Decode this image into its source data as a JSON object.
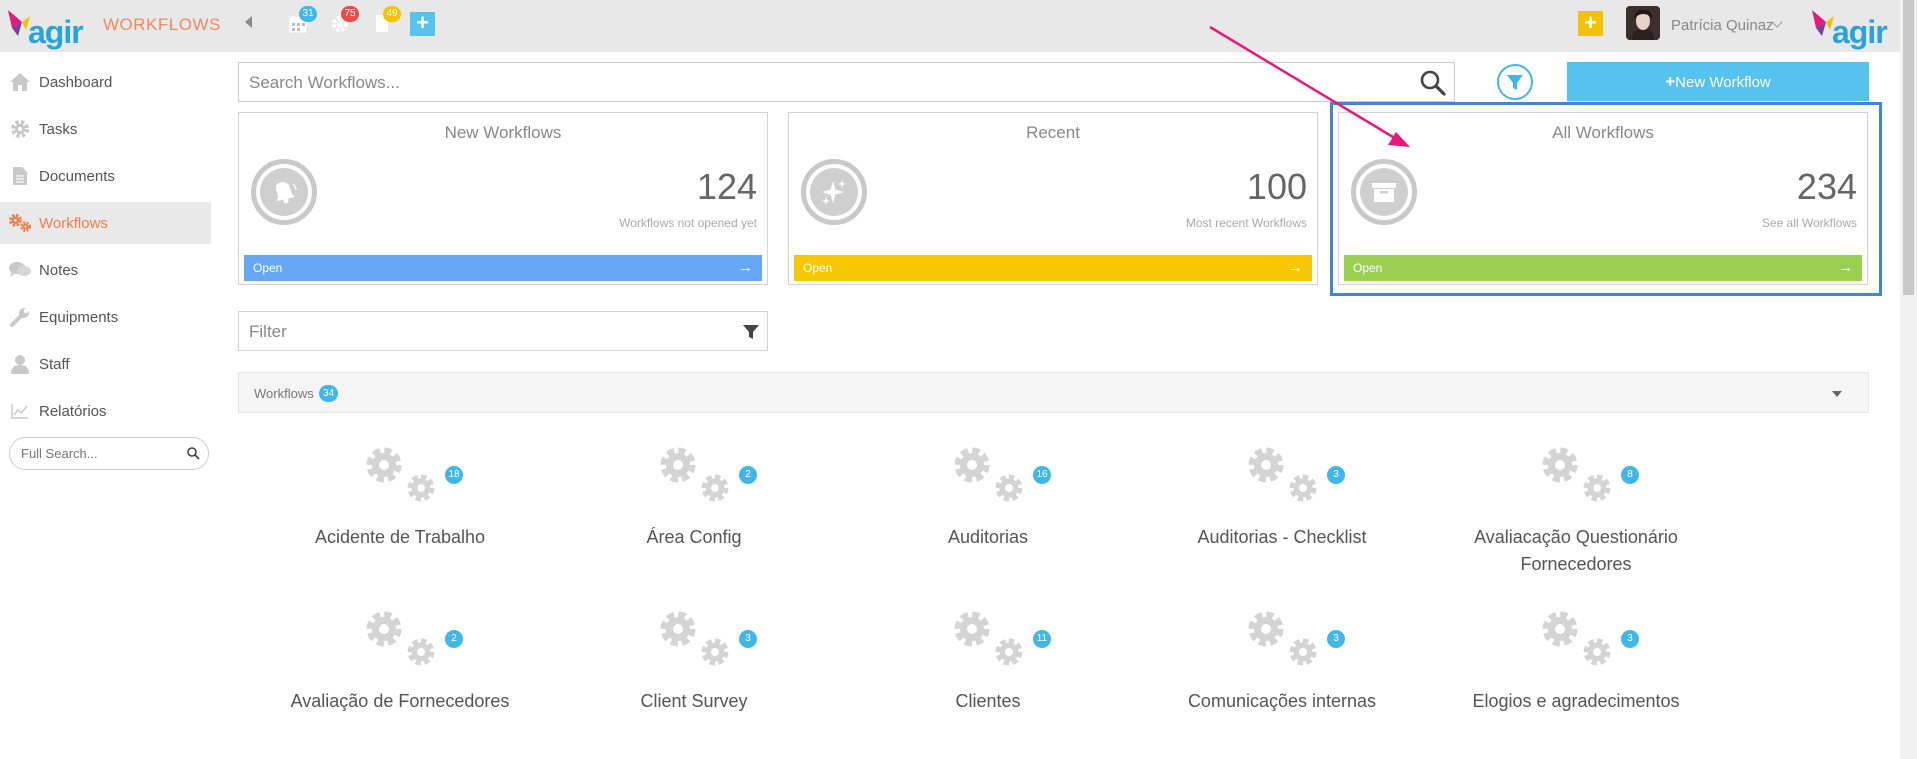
{
  "app": {
    "logo": "agir",
    "module": "WORKFLOWS"
  },
  "topbar": {
    "calendar_badge": "31",
    "settings_badge": "75",
    "docs_badge": "49",
    "user_name": "Patrícia Quinaz",
    "colors": {
      "blue_badge": "#41b7e8",
      "red_badge": "#e94b4b",
      "yellow_badge": "#f3c300"
    }
  },
  "sidebar": {
    "items": [
      {
        "label": "Dashboard",
        "icon": "home-icon"
      },
      {
        "label": "Tasks",
        "icon": "gear-icon"
      },
      {
        "label": "Documents",
        "icon": "document-icon"
      },
      {
        "label": "Workflows",
        "icon": "gears-icon"
      },
      {
        "label": "Notes",
        "icon": "comments-icon"
      },
      {
        "label": "Equipments",
        "icon": "wrench-icon"
      },
      {
        "label": "Staff",
        "icon": "user-icon"
      },
      {
        "label": "Relatórios",
        "icon": "chart-icon"
      }
    ],
    "active": "Workflows",
    "search_placeholder": "Full Search..."
  },
  "main": {
    "search_placeholder": "Search Workflows...",
    "new_button": "New Workflow",
    "cards": [
      {
        "title": "New Workflows",
        "count": "124",
        "subtitle": "Workflows not opened yet",
        "action": "Open",
        "color": "#66a8f4",
        "icon": "bell-icon"
      },
      {
        "title": "Recent",
        "count": "100",
        "subtitle": "Most recent Workflows",
        "action": "Open",
        "color": "#f7c800",
        "icon": "sparkle-icon"
      },
      {
        "title": "All Workflows",
        "count": "234",
        "subtitle": "See all Workflows",
        "action": "Open",
        "color": "#9bcf53",
        "icon": "archive-icon"
      }
    ],
    "filter_placeholder": "Filter",
    "group": {
      "label": "Workflows",
      "count": "34"
    },
    "workflows": [
      {
        "name": "Acidente de Trabalho",
        "count": "18"
      },
      {
        "name": "Área Config",
        "count": "2"
      },
      {
        "name": "Auditorias",
        "count": "16"
      },
      {
        "name": "Auditorias - Checklist",
        "count": "3"
      },
      {
        "name": "Avaliacação Questionário Fornecedores",
        "count": "8"
      },
      {
        "name": "Avaliação de Fornecedores",
        "count": "2"
      },
      {
        "name": "Client Survey",
        "count": "3"
      },
      {
        "name": "Clientes",
        "count": "11"
      },
      {
        "name": "Comunicações internas",
        "count": "3"
      },
      {
        "name": "Elogios e agradecimentos",
        "count": "3"
      }
    ]
  },
  "annotation": {
    "arrow_color": "#e8177d",
    "highlight_color": "#3d87d4"
  }
}
